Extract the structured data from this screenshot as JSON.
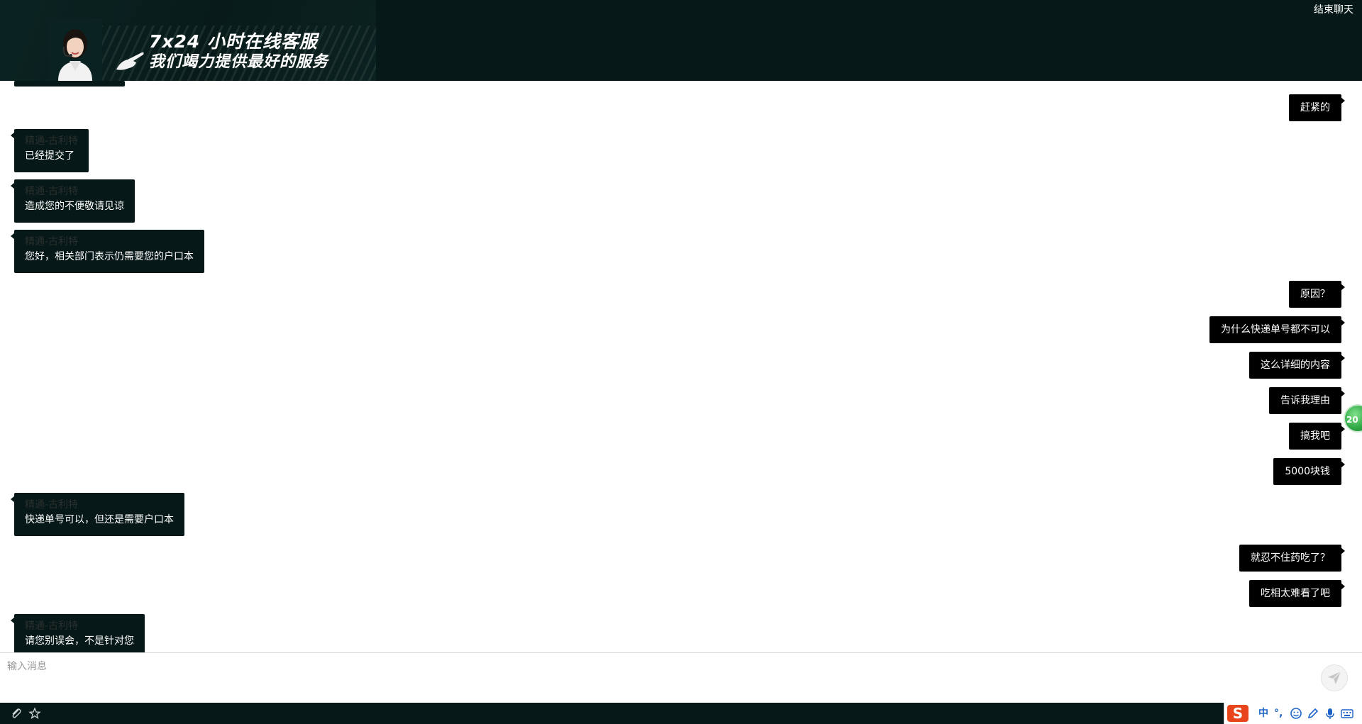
{
  "header": {
    "banner_line1": "7x24 小时在线客服",
    "banner_line2": "我们竭力提供最好的服务",
    "end_chat_label": "结束聊天"
  },
  "messages": [
    {
      "side": "right",
      "text": "赶紧的"
    },
    {
      "side": "left",
      "sender": "精通-古利特",
      "text": "已经提交了"
    },
    {
      "side": "left",
      "sender": "精通-古利特",
      "text": "造成您的不便敬请见谅"
    },
    {
      "side": "left",
      "sender": "精通-古利特",
      "text": "您好，相关部门表示仍需要您的户口本"
    },
    {
      "side": "right",
      "text": "原因？"
    },
    {
      "side": "right",
      "text": "为什么快递单号都不可以"
    },
    {
      "side": "right",
      "text": "这么详细的内容"
    },
    {
      "side": "right",
      "text": "告诉我理由"
    },
    {
      "side": "right",
      "text": "搞我吧"
    },
    {
      "side": "right",
      "text": "5000块钱"
    },
    {
      "side": "left",
      "sender": "精通-古利特",
      "text": "快递单号可以，但还是需要户口本"
    },
    {
      "side": "right",
      "text": "就忍不住药吃了？"
    },
    {
      "side": "right",
      "text": "吃相太难看了吧"
    },
    {
      "side": "left",
      "sender": "精通-古利特",
      "text": "请您别误会，不是针对您"
    }
  ],
  "float_badge": "20",
  "input": {
    "placeholder": "输入消息"
  },
  "toolbar": {
    "icons": [
      "paperclip-icon",
      "star-icon"
    ]
  },
  "ime": {
    "logo": "S",
    "lang": "中",
    "punct": "°,",
    "icons": [
      "emoji-icon",
      "pen-icon",
      "mic-icon",
      "keyboard-icon"
    ]
  },
  "colors": {
    "header_bg": "#061817",
    "left_bubble": "#061817",
    "right_bubble": "#000000",
    "ime_accent": "#1e64c8",
    "ime_logo": "#e8451d"
  }
}
